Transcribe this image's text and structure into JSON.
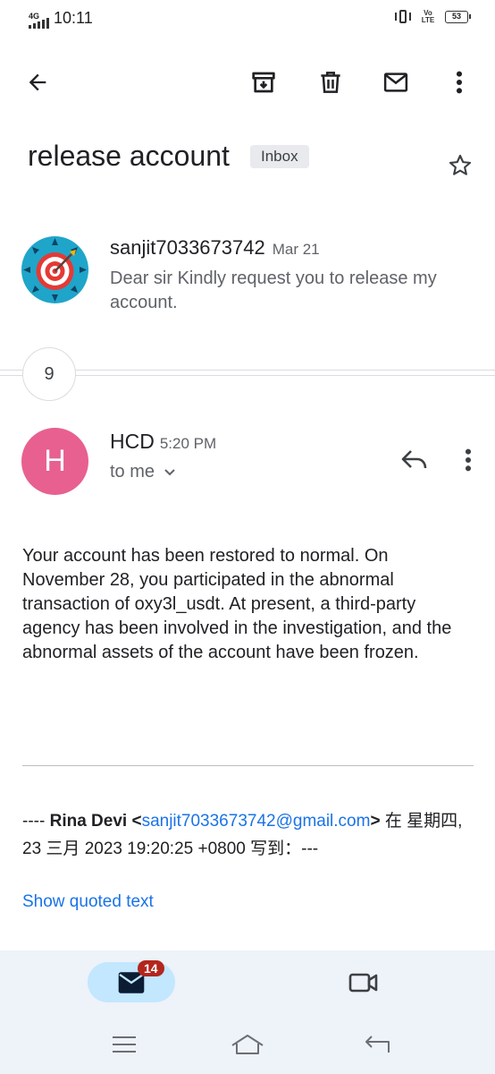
{
  "status_bar": {
    "network": "4G",
    "time": "10:11",
    "volte": "Vo LTE",
    "battery": "53"
  },
  "toolbar": {
    "back_icon": "arrow-back-icon",
    "archive_icon": "archive-icon",
    "delete_icon": "trash-icon",
    "mark_unread_icon": "mail-icon",
    "more_icon": "more-vert-icon"
  },
  "thread": {
    "subject": "release account",
    "label": "Inbox",
    "star_icon": "star-outline-icon"
  },
  "message_1": {
    "sender": "sanjit7033673742",
    "date": "Mar 21",
    "snippet": "Dear sir Kindly request you to release my account."
  },
  "collapsed": {
    "count": "9"
  },
  "message_2": {
    "avatar_letter": "H",
    "sender": "HCD",
    "time": "5:20 PM",
    "to": "to me",
    "body": "Your account has been restored to normal. On November 28, you participated in the abnormal transaction of oxy3l_usdt. At present, a third-party agency has been involved in the investigation, and the abnormal assets of the account have been frozen.",
    "quote_prefix": "---- ",
    "quote_name": "Rina Devi",
    "quote_lt": " <",
    "quote_email": "sanjit7033673742@gmail.com",
    "quote_gt": ">",
    "quote_suffix": " 在 星期四, 23 三月 2023 19:20:25 +0800 写到：---",
    "show_quoted": "Show quoted text"
  },
  "bottom_nav": {
    "mail_badge": "14"
  },
  "colors": {
    "accent": "#1a73e8",
    "avatar_h": "#e8608f",
    "badge": "#b3261e",
    "mail_tab": "#c2e7ff"
  }
}
